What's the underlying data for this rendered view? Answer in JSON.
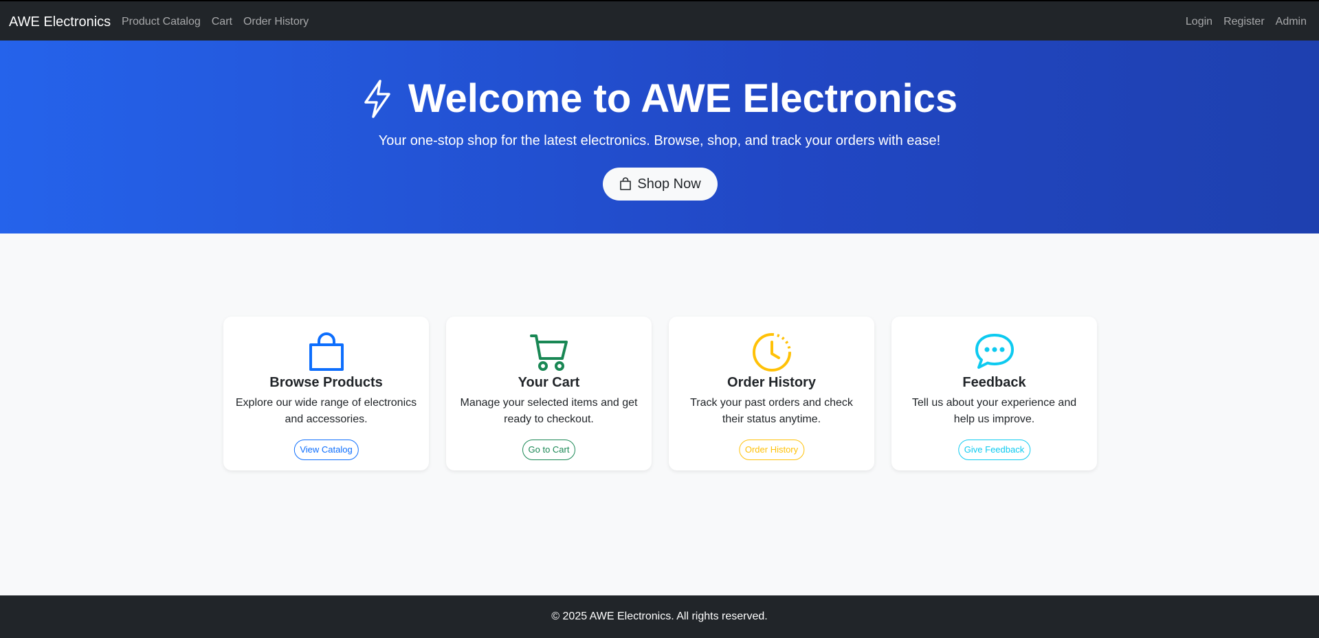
{
  "navbar": {
    "brand": "AWE Electronics",
    "left_links": [
      "Product Catalog",
      "Cart",
      "Order History"
    ],
    "right_links": [
      "Login",
      "Register",
      "Admin"
    ]
  },
  "hero": {
    "icon": "lightning-icon",
    "title": "Welcome to AWE Electronics",
    "subtitle": "Your one-stop shop for the latest electronics. Browse, shop, and track your orders with ease!",
    "button_label": "Shop Now",
    "button_icon": "shopping-bag-icon"
  },
  "cards": [
    {
      "icon": "shopping-bag-icon",
      "title": "Browse Products",
      "text": "Explore our wide range of electronics and accessories.",
      "button_label": "View Catalog",
      "color": "#0d6efd"
    },
    {
      "icon": "cart-icon",
      "title": "Your Cart",
      "text": "Manage your selected items and get ready to checkout.",
      "button_label": "Go to Cart",
      "color": "#198754"
    },
    {
      "icon": "clock-history-icon",
      "title": "Order History",
      "text": "Track your past orders and check their status anytime.",
      "button_label": "Order History",
      "color": "#ffc107"
    },
    {
      "icon": "chat-dots-icon",
      "title": "Feedback",
      "text": "Tell us about your experience and help us improve.",
      "button_label": "Give Feedback",
      "color": "#0dcaf0"
    }
  ],
  "footer": {
    "text": "© 2025 AWE Electronics. All rights reserved."
  }
}
